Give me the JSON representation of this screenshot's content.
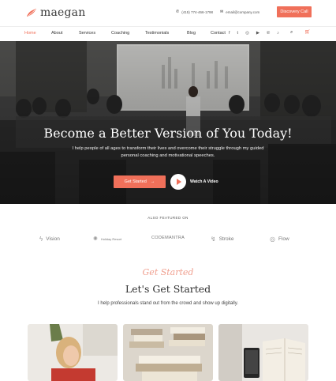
{
  "header": {
    "logo": "maegan",
    "phone": "(415) 774-466-1798",
    "email": "email@company.com",
    "cta": "Discovery Call"
  },
  "colors": {
    "accent": "#f0705a",
    "dark": "#2e2e2e"
  },
  "nav": {
    "items": [
      "Home",
      "About",
      "Services",
      "Coaching",
      "Testimonials",
      "Blog",
      "Contact"
    ],
    "active": "Home",
    "social_icons": [
      "facebook-icon",
      "twitter-icon",
      "instagram-icon",
      "youtube-icon",
      "pinterest-icon",
      "tiktok-icon"
    ]
  },
  "hero": {
    "title": "Become a Better Version of You Today!",
    "subtitle": "I help people of all ages to transform their lives and overcome their struggle through my guided personal coaching and motivational speeches.",
    "primary_button": "Get Started",
    "video_button": "Watch A Video"
  },
  "featured": {
    "label": "ALSO FEATURED ON",
    "brands": [
      "Vision",
      "Holiday Resort",
      "CODEMANTRA",
      "Stroke",
      "Flow"
    ]
  },
  "started": {
    "script": "Get Started",
    "title": "Let's Get Started",
    "subtitle": "I help professionals stand out from the crowd and show up digitally."
  }
}
